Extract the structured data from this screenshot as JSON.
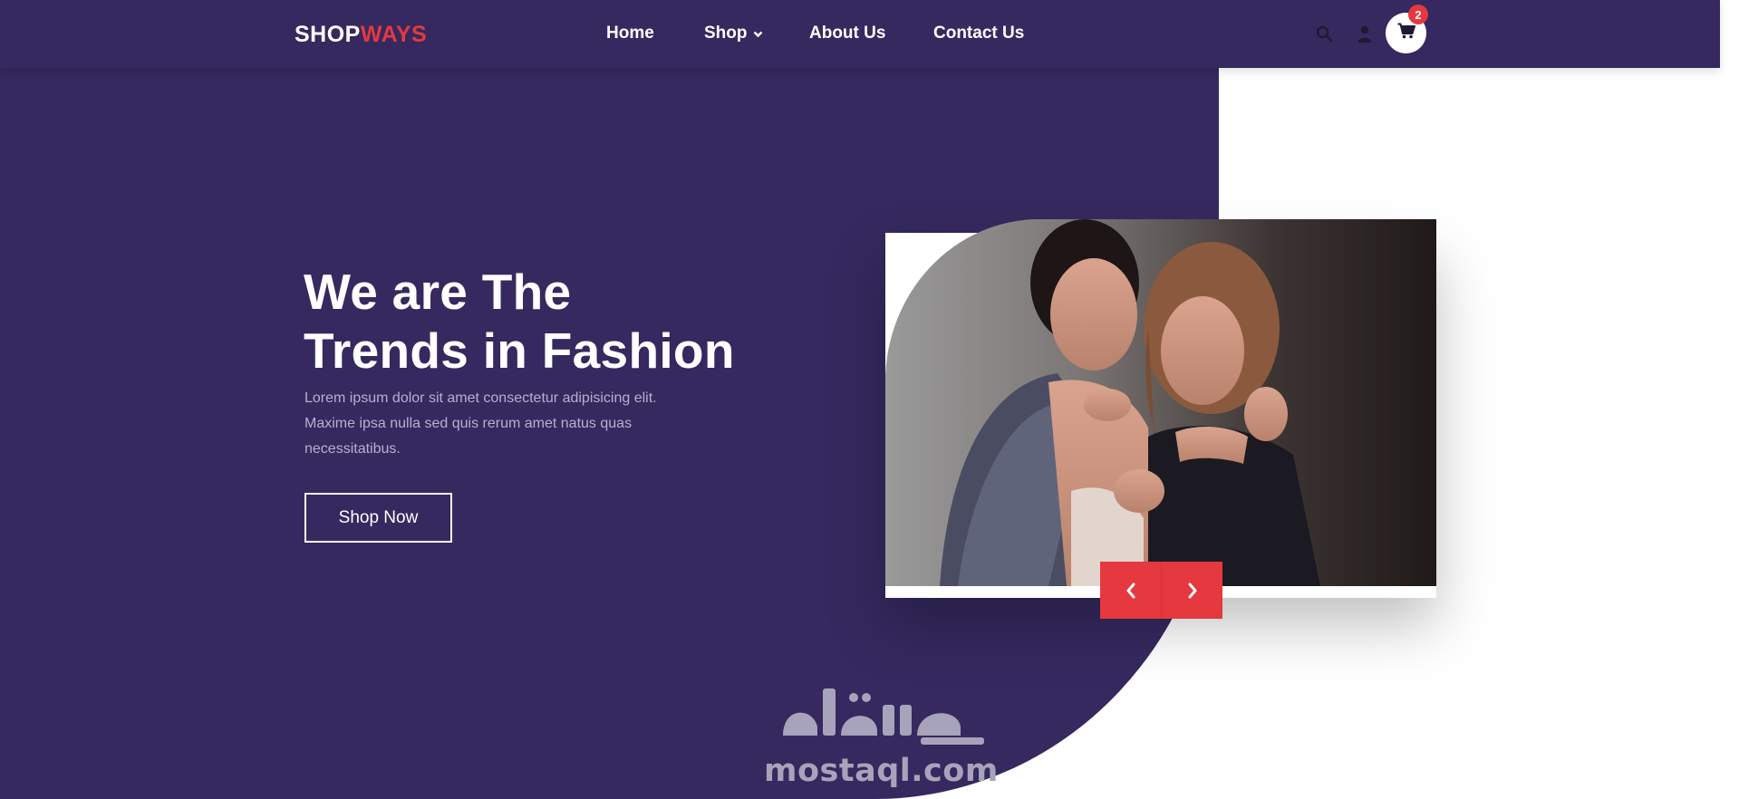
{
  "header": {
    "logo_primary": "SHOP",
    "logo_accent": "WAYS",
    "nav": {
      "home": "Home",
      "shop": "Shop",
      "about": "About Us",
      "contact": "Contact Us"
    },
    "icons": [
      "search-icon",
      "user-icon",
      "cart-icon",
      "chevron-down-icon"
    ],
    "cart_count": "2"
  },
  "hero": {
    "title_line1": "We are The",
    "title_line2": "Trends in Fashion",
    "description": "Lorem ipsum dolor sit amet consectetur adipisicing elit. Maxime ipsa nulla sed quis rerum amet natus quas necessitatibus.",
    "cta_label": "Shop Now",
    "image_alt": "Two women in fashion outfits posing together",
    "slider_icons": [
      "chevron-left-icon",
      "chevron-right-icon"
    ]
  },
  "watermark": {
    "latin": "mostaql.com"
  },
  "colors": {
    "primary": "#35295f",
    "accent": "#e5383f",
    "white": "#ffffff",
    "muted_text": "#b6b0d0"
  }
}
